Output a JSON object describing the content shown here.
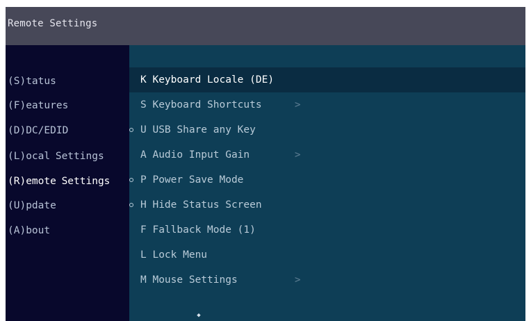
{
  "window": {
    "title": "Remote Settings"
  },
  "sidebar": {
    "items": [
      {
        "label": "(S)tatus"
      },
      {
        "label": "(F)eatures"
      },
      {
        "label": "(D)DC/EDID"
      },
      {
        "label": "(L)ocal  Settings"
      },
      {
        "label": "(R)emote Settings"
      },
      {
        "label": "(U)pdate"
      },
      {
        "label": "(A)bout"
      }
    ],
    "active_index": 4
  },
  "menu": {
    "items": [
      {
        "label": "K Keyboard Locale (DE)",
        "selected": true,
        "dot": false,
        "submenu": false
      },
      {
        "label": "S Keyboard Shortcuts",
        "selected": false,
        "dot": false,
        "submenu": true
      },
      {
        "label": "U USB Share any Key",
        "selected": false,
        "dot": true,
        "submenu": false
      },
      {
        "label": "A Audio Input Gain",
        "selected": false,
        "dot": false,
        "submenu": true
      },
      {
        "label": "P Power Save Mode",
        "selected": false,
        "dot": true,
        "submenu": false
      },
      {
        "label": "H Hide Status Screen",
        "selected": false,
        "dot": true,
        "submenu": false
      },
      {
        "label": "F Fallback Mode (1)",
        "selected": false,
        "dot": false,
        "submenu": false
      },
      {
        "label": "L Lock Menu",
        "selected": false,
        "dot": false,
        "submenu": false
      },
      {
        "label": "M Mouse Settings",
        "selected": false,
        "dot": false,
        "submenu": true
      }
    ],
    "submenu_glyph": ">",
    "scroll_more_glyph": "◆"
  },
  "icons": {
    "option_dot": "circle-dot-icon",
    "submenu_arrow": "chevron-right-icon",
    "scroll_down": "scroll-down-icon"
  },
  "colors": {
    "title_bar": "#474858",
    "sidebar_bg": "#08082c",
    "content_bg": "#0e3e56",
    "selected_row": "#0a2c42",
    "text": "#b9cbd8",
    "text_active": "#ffffff"
  }
}
